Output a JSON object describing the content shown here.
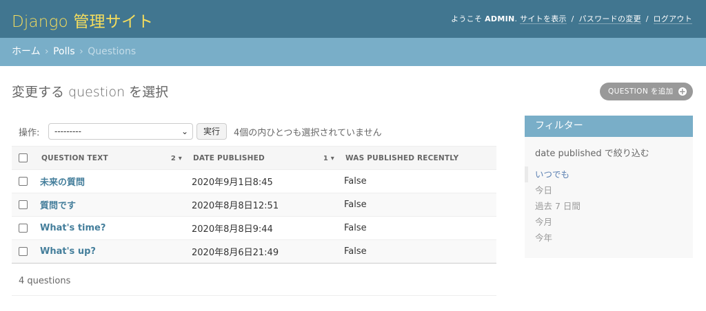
{
  "header": {
    "site_title": "Django 管理サイト",
    "welcome": "ようこそ",
    "username": "ADMIN",
    "links": [
      "サイトを表示",
      "パスワードの変更",
      "ログアウト"
    ],
    "separator": "/"
  },
  "breadcrumbs": {
    "items": [
      "ホーム",
      "Polls",
      "Questions"
    ],
    "separator": "›"
  },
  "page": {
    "title": "変更する question を選択",
    "add_button": "QUESTION を追加",
    "add_icon": "plus-icon"
  },
  "actions": {
    "label": "操作:",
    "select_value": "---------",
    "go_button": "実行",
    "counter": "4個の内ひとつも選択されていません"
  },
  "table": {
    "columns": [
      {
        "label": "QUESTION TEXT",
        "sort_priority": "2",
        "sort_icon": "sort-descending-icon"
      },
      {
        "label": "DATE PUBLISHED",
        "sort_priority": "1",
        "sort_icon": "sort-descending-icon"
      },
      {
        "label": "WAS PUBLISHED RECENTLY"
      }
    ],
    "rows": [
      {
        "question": "未来の質問",
        "date": "2020年9月1日8:45",
        "recent": "False"
      },
      {
        "question": "質問です",
        "date": "2020年8月8日12:51",
        "recent": "False"
      },
      {
        "question": "What's time?",
        "date": "2020年8月8日9:44",
        "recent": "False"
      },
      {
        "question": "What's up?",
        "date": "2020年8月6日21:49",
        "recent": "False"
      }
    ]
  },
  "paginator": {
    "text": "4 questions"
  },
  "filter": {
    "heading": "フィルター",
    "title": "date published で絞り込む",
    "options": [
      "いつでも",
      "今日",
      "過去 7 日間",
      "今月",
      "今年"
    ],
    "selected_index": 0
  },
  "colors": {
    "header_bg": "#417690",
    "brand": "#f5dd5d",
    "breadcrumb_bg": "#79aec8",
    "link": "#447e9b"
  }
}
